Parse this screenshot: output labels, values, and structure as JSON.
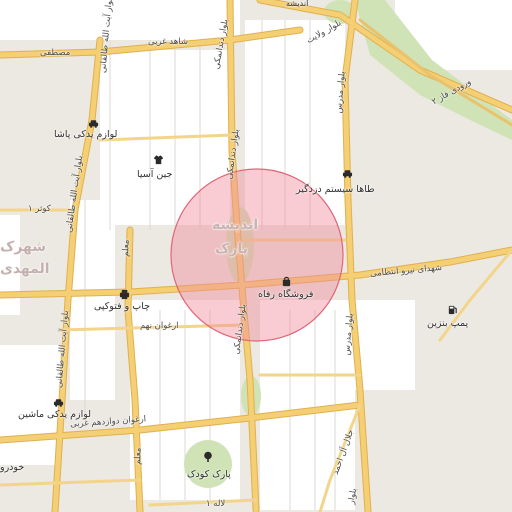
{
  "map": {
    "colors": {
      "background": "#ece8e2",
      "block": "#ffffff",
      "road_fill": "#f5cf73",
      "road_casing": "#e0b04e",
      "highway": "#f1d37d",
      "park": "#cfe3b6",
      "search_circle_fill": "#f08f9c",
      "search_circle_stroke": "#e06677"
    },
    "area_labels": {
      "andisheh": "اندیشه",
      "park": "پارک",
      "shahrak": "شهرک",
      "mahdieh": "المهدی"
    },
    "road_labels": {
      "shahed_gharbi": "شاهد غربی",
      "mostafa": "مصطفی",
      "bolvar_vilayat": "بلوار ولایت",
      "vorudi_fazeh_2": "ورودی فاز ۲",
      "bolvar_modares_top": "بلوار مدرس",
      "bolvar_dandanmaki_top": "بلوار دندانمکی",
      "bolvar_dandanmaki_mid": "بلوار دندانمکی",
      "bolvar_dandanmaki_bottom": "بلوار دندانمکی",
      "bolvar_ayatollah_taleghani_top": "بلوار آیت الله طالقانی",
      "bolvar_ayatollah_taleghani_mid": "بلوار آیت الله طالقانی",
      "bolvar_ayatollah_taleghani_bottom": "بلوار آیت الله طالقانی",
      "kowsar": "کوثر ۱",
      "moallem": "معلم",
      "moallem_bottom": "معلم",
      "shohada_niru": "شهدای نیرو انتظامی",
      "bolvar_modares_mid": "بلوار مدرس",
      "arghavan_noham": "ارغوان نهم",
      "arghavan_davazdahom": "ارغوان دوازدهم غربی",
      "jalal_al_ahmad": "جلال آل احمد",
      "laleh": "لاله ۱",
      "bolvar_bottom": "بلوار"
    },
    "pois": {
      "lavazem_yadaki_pasha": "لوازم یدکی پاشا",
      "jeen_asia": "جین آسیا",
      "taha_system": "طاها سیستم دزدگیر",
      "forooshgah_refah": "فروشگاه رفاه",
      "chap_fotokopi": "چاپ و فتوکپی",
      "pomp_benzin": "پمپ بنزین",
      "lavazem_yadaki_mashin": "لوازم یدکی ماشین",
      "park_koodak": "پارک کودک",
      "khodro": "خودرو",
      "top_label": "اندیشه"
    },
    "icons": {
      "shopping_bag": "shopping-bag-icon",
      "car": "car-icon",
      "clothing": "shirt-icon",
      "fuel": "fuel-pump-icon",
      "tree": "tree-icon",
      "printer": "printer-icon"
    }
  }
}
